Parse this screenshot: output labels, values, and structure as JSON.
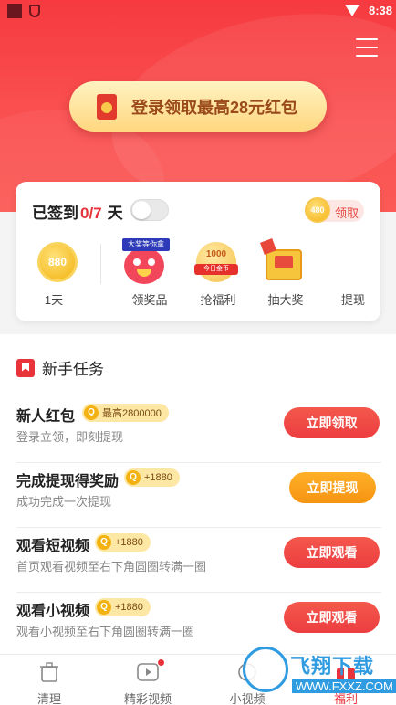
{
  "status_bar": {
    "time": "8:38"
  },
  "login_banner": {
    "text": "登录领取最高28元红包"
  },
  "checkin": {
    "prefix": "已签到",
    "days": "0/7",
    "unit": "天",
    "claim_coin": "480",
    "claim_label": "领取",
    "items": [
      {
        "label": "1天",
        "coin": "880",
        "icon": "coin-icon"
      },
      {
        "label": "领奖品",
        "tag": "大奖等你拿",
        "icon": "prize-icon"
      },
      {
        "label": "抢福利",
        "num": "1000",
        "band": "今日金币",
        "icon": "welfare-icon"
      },
      {
        "label": "抽大奖",
        "icon": "lottery-icon"
      },
      {
        "label": "提现",
        "icon": "withdraw-icon"
      }
    ]
  },
  "tasks": {
    "title": "新手任务",
    "items": [
      {
        "name": "新人红包",
        "reward": "最高2800000",
        "desc": "登录立领，即刻提现",
        "button": "立即领取",
        "button_color": "#ec3d40"
      },
      {
        "name": "完成提现得奖励",
        "reward": "+1880",
        "desc": "成功完成一次提现",
        "button": "立即提现",
        "button_color": "#f69412"
      },
      {
        "name": "观看短视频",
        "reward": "+1880",
        "desc": "首页观看视频至右下角圆圈转满一圈",
        "button": "立即观看",
        "button_color": "#ec3d40"
      },
      {
        "name": "观看小视频",
        "reward": "+1880",
        "desc": "观看小视频至右下角圆圈转满一圈",
        "button": "立即观看",
        "button_color": "#ec3d40"
      }
    ]
  },
  "bottom_nav": [
    {
      "label": "清理",
      "icon": "trash-icon"
    },
    {
      "label": "精彩视频",
      "icon": "video-play-icon"
    },
    {
      "label": "小视频",
      "icon": "short-video-icon"
    },
    {
      "label": "福利",
      "icon": "gift-icon",
      "active": true
    }
  ],
  "watermark": {
    "text": "飞翔下载",
    "url": "WWW.FXXZ.COM"
  },
  "colors": {
    "primary_red": "#e8333b",
    "orange": "#f69412",
    "gold": "#f3b211"
  }
}
